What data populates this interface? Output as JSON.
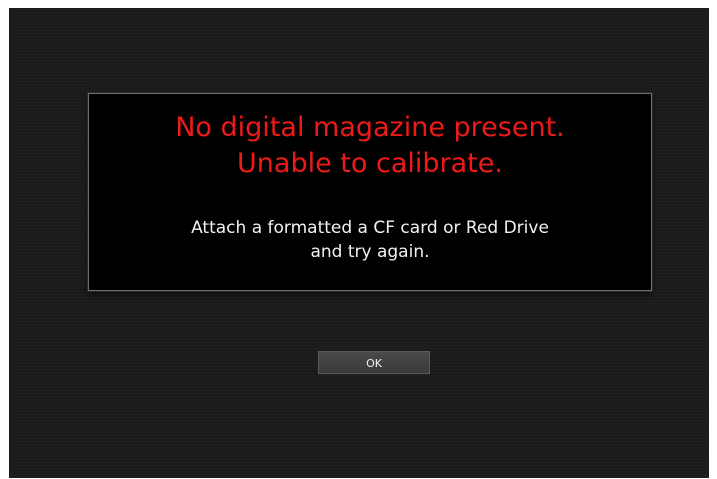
{
  "dialog": {
    "error_lines": [
      "No digital magazine present.",
      "Unable to calibrate."
    ],
    "info_lines": [
      "Attach a formatted a CF card or Red Drive",
      "and try again."
    ]
  },
  "button": {
    "ok_label": "OK"
  },
  "colors": {
    "background": "#1b1b1b",
    "dialog_background": "#000000",
    "error_text": "#ee1a1a",
    "info_text": "#f2f2f2"
  }
}
